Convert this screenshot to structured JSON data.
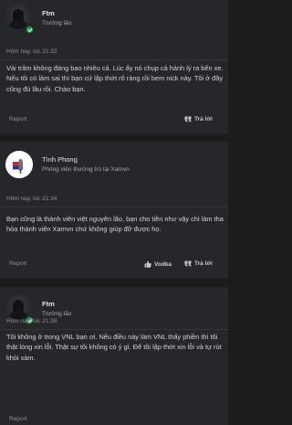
{
  "comments": [
    {
      "author": "Ftm",
      "role": "Trưởng lão",
      "timestamp": "Hôm nay, lúc 21:32",
      "body": "Vài trăm không đáng bao nhiêu cả. Lúc ấy nó chụp cả hành lý ra bến xe. Nếu tôi có làm sai thì bạn cứ lập thớt rõ ràng rồi bem nick này. Tôi ở đây cũng đủ lâu rồi. Chào bạn.",
      "report_label": "Report",
      "reply_label": "Trả lời"
    },
    {
      "author": "Tình Phong",
      "role": "Phóng viên thường trú tại Xamvn",
      "timestamp": "Hôm nay, lúc 21:34",
      "body": "Bạn cũng là thành viên việt nguyên lão, bạn cho tiền như vậy chỉ làm tha hóa thành viên Xamvn chứ không giúp đỡ được họ.",
      "report_label": "Report",
      "like_label": "Vodka",
      "reply_label": "Trả lời"
    },
    {
      "author": "Ftm",
      "role": "Trưởng lão",
      "timestamp": "Hôm nay, lúc 21:38",
      "body": "Tôi không ở trong VNL bạn ơi. Nếu điều này làm VNL thấy phiền thì tôi thật lòng xin lỗi. Thật sự tôi không có ý gì. Để tôi lập thớt xin lỗi và tự rút khỏi xàm.",
      "report_label": "Report"
    }
  ],
  "colors": {
    "background": "#1b1c1e",
    "card": "#26272a",
    "online_badge": "#1fa34a"
  },
  "icons": {
    "reply": "reply-quote-icon",
    "like": "thumbs-up-icon",
    "avatar_badge": "online-check-icon"
  }
}
